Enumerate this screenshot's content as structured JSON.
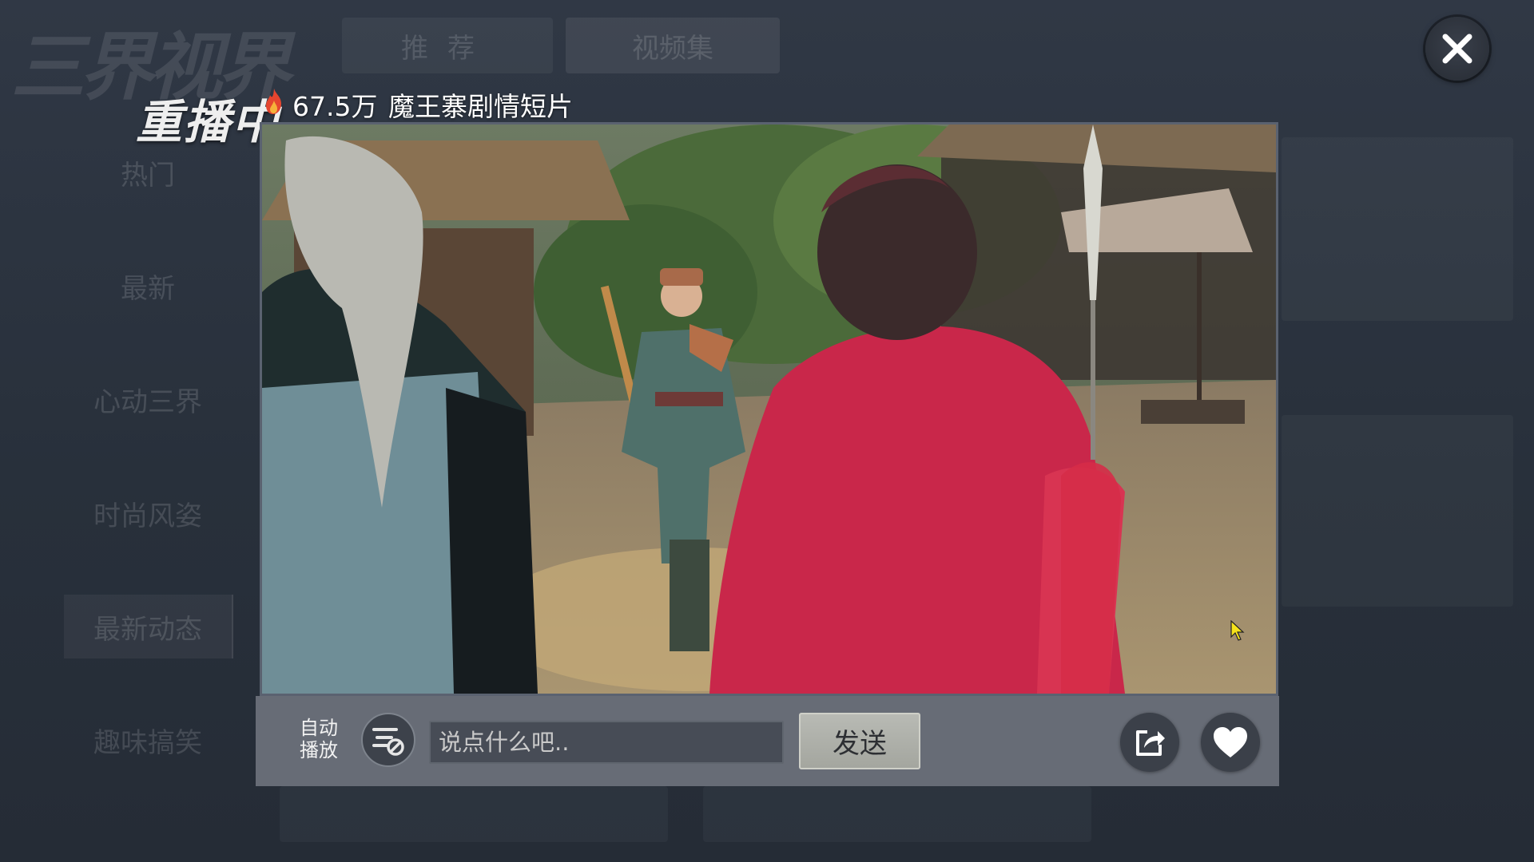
{
  "app": {
    "logo_text": "三界视界"
  },
  "top_tabs": [
    {
      "label": "推荐"
    },
    {
      "label": "视频集"
    }
  ],
  "sidebar": {
    "items": [
      {
        "label": "热门"
      },
      {
        "label": "最新"
      },
      {
        "label": "心动三界"
      },
      {
        "label": "时尚风姿"
      },
      {
        "label": "最新动态",
        "active": true
      },
      {
        "label": "趣味搞笑"
      }
    ]
  },
  "player": {
    "replay_label": "重播中",
    "views": "67.5万",
    "title": "魔王寨剧情短片"
  },
  "controls": {
    "auto_play_line1": "自动",
    "auto_play_line2": "播放",
    "comment_placeholder": "说点什么吧..",
    "comment_value": "",
    "send_label": "发送"
  },
  "icons": {
    "close": "close-icon",
    "fire": "fire-icon",
    "barrage": "barrage-toggle-icon",
    "share": "share-icon",
    "like": "heart-icon",
    "cursor": "mouse-cursor-icon"
  },
  "colors": {
    "background": "#2b3340",
    "control_bar": "#6c727c",
    "send_button": "#b0b2ab",
    "player_border": "#5a6270"
  }
}
